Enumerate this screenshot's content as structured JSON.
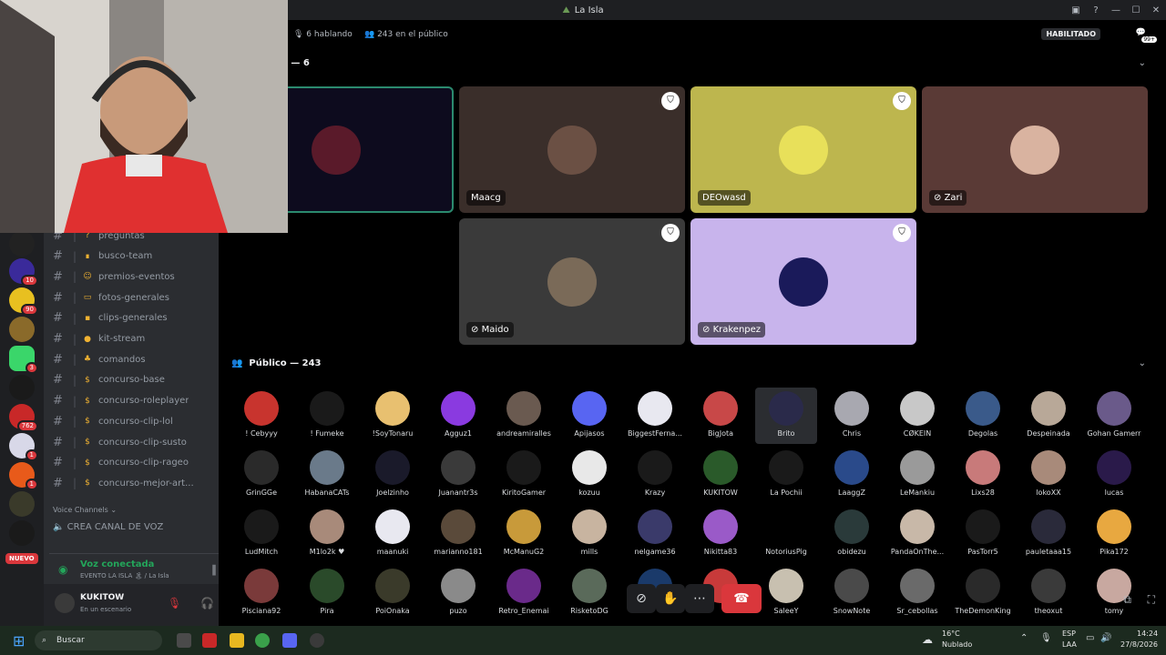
{
  "window": {
    "title": "La Isla"
  },
  "stage_header": {
    "speaking": "6 hablando",
    "audience": "243 en el público",
    "enabled": "HABILITADO",
    "notif": "99+"
  },
  "speakers_header": "s — 6",
  "speakers": [
    {
      "name": "",
      "bg": "#0d0b1e",
      "avatar": "#5a1a2a",
      "mod": false,
      "muted": false
    },
    {
      "name": "Maacg",
      "bg": "#3a2e2a",
      "avatar": "#6b5044",
      "mod": true,
      "muted": false
    },
    {
      "name": "DEOwasd",
      "bg": "#bdb64e",
      "avatar": "#e8e05a",
      "mod": true,
      "muted": false
    },
    {
      "name": "Zari",
      "bg": "#5a3a36",
      "avatar": "#d9b3a0",
      "mod": false,
      "muted": true
    },
    {
      "name": "Maido",
      "bg": "#3a3a3a",
      "avatar": "#7a6a58",
      "mod": true,
      "muted": true
    },
    {
      "name": "Krakenpez",
      "bg": "#c8b4ec",
      "avatar": "#1a1a5a",
      "mod": true,
      "muted": true
    }
  ],
  "audience_header": "Público — 243",
  "audience": [
    [
      "! Cebyyy",
      "! Fumeke",
      "!SoyTonaru",
      "Agguz1",
      "andreamiralles",
      "Apijasos",
      "BiggestFerna...",
      "BigJota",
      "Brito",
      "Chris",
      "CØKEIN",
      "Degolas",
      "Despeinada",
      "Gohan Gamerr"
    ],
    [
      "GrinGGe",
      "HabanaCATs",
      "Joelzinho",
      "Juanantr3s",
      "KiritoGamer",
      "kozuu",
      "Krazy",
      "KUKITOW",
      "La Pochii",
      "LaaggZ",
      "LeMankiu",
      "Lixs28",
      "lokoXX",
      "lucas"
    ],
    [
      "LudMitch",
      "M1lo2k ♥",
      "maanuki",
      "marianno181",
      "McManuG2",
      "mills",
      "nelgame36",
      "Nikitta83",
      "NotoriusPig",
      "obidezu",
      "PandaOnThe...",
      "PasTorr5",
      "pauletaaa15",
      "Pika172"
    ],
    [
      "Pisciana92",
      "Pira",
      "PoiOnaka",
      "puzo",
      "Retro_Enemai",
      "RisketoDG",
      "",
      "",
      "SaleeY",
      "SnowNote",
      "Sr_cebollas",
      "TheDemonKing",
      "theoxut",
      "tomy"
    ]
  ],
  "audience_colors": [
    [
      "#c8342e",
      "#1a1a1a",
      "#e8c070",
      "#8a3ae0",
      "#6a5a50",
      "#5865f2",
      "#e8e8f0",
      "#c84848",
      "#2a2a4a",
      "#a8a8b0",
      "#c8c8c8",
      "#3a5a8a",
      "#b8a898",
      "#6a5a8a"
    ],
    [
      "#2a2a2a",
      "#6a7a8a",
      "#1a1a2a",
      "#3a3a3a",
      "#1a1a1a",
      "#e8e8e8",
      "#1a1a1a",
      "#2a5a2a",
      "#1a1a1a",
      "#2a4a8a",
      "#9a9a9a",
      "#c87a7a",
      "#a88a7a",
      "#2a1a4a"
    ],
    [
      "#1a1a1a",
      "#a88a7a",
      "#e8e8f0",
      "#5a4a3a",
      "#c89a3a",
      "#c8b4a0",
      "#3a3a6a",
      "#9a5ac8",
      "#000000",
      "#2a3a3a",
      "#c8b8a8",
      "#1a1a1a",
      "#2a2a3a",
      "#e8a840"
    ],
    [
      "#7a3a3a",
      "#2a4a2a",
      "#3a3a2a",
      "#8a8a8a",
      "#6a2a8a",
      "#5a6a5a",
      "#1a3a6a",
      "#c83a3a",
      "#c8c0b0",
      "#4a4a4a",
      "#6a6a6a",
      "#2a2a2a",
      "#3a3a3a",
      "#c8a8a0"
    ]
  ],
  "channels": [
    {
      "label": "preguntas",
      "emo": "?"
    },
    {
      "label": "busco-team",
      "emo": "∎"
    },
    {
      "label": "premios-eventos",
      "emo": "☺"
    },
    {
      "label": "fotos-generales",
      "emo": "▭"
    },
    {
      "label": "clips-generales",
      "emo": "▪"
    },
    {
      "label": "kit-stream",
      "emo": "●"
    },
    {
      "label": "comandos",
      "emo": "♣"
    },
    {
      "label": "concurso-base",
      "emo": "$"
    },
    {
      "label": "concurso-roleplayer",
      "emo": "$"
    },
    {
      "label": "concurso-clip-lol",
      "emo": "$"
    },
    {
      "label": "concurso-clip-susto",
      "emo": "$"
    },
    {
      "label": "concurso-clip-rageo",
      "emo": "$"
    },
    {
      "label": "concurso-mejor-art...",
      "emo": "$"
    }
  ],
  "voice_channels": {
    "header": "Voice Channels",
    "create": "CREA CANAL DE VOZ"
  },
  "voice_status": {
    "connected": "Voz conectada",
    "location": "EVENTO LA ISLA 🏝 / La Isla"
  },
  "user": {
    "name": "KUKITOW",
    "status": "En un escenario"
  },
  "rail_badges": [
    "10",
    "90",
    "3",
    "762",
    "1",
    "1"
  ],
  "rail_new": "NUEVO",
  "taskbar": {
    "search": "Buscar",
    "temp": "16°C",
    "weather": "Nublado",
    "lang1": "ESP",
    "lang2": "LAA",
    "time": "14:24",
    "date": "27/8/2026"
  }
}
